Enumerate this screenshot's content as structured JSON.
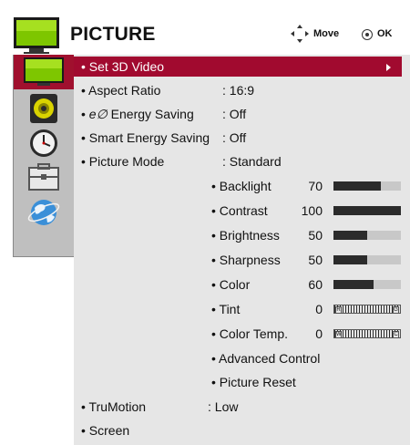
{
  "header": {
    "title": "PICTURE",
    "move_label": "Move",
    "ok_label": "OK"
  },
  "sidebar": {
    "tabs": [
      {
        "icon": "picture-tv-icon",
        "active": true
      },
      {
        "icon": "speaker-icon",
        "active": false
      },
      {
        "icon": "clock-icon",
        "active": false
      },
      {
        "icon": "toolbox-icon",
        "active": false
      },
      {
        "icon": "globe-icon",
        "active": false
      }
    ]
  },
  "menu": {
    "set3d": {
      "label": "• Set 3D Video"
    },
    "aspect": {
      "label": "• Aspect Ratio",
      "value": ": 16:9"
    },
    "energy": {
      "label_prefix": "• ",
      "label_icon": "e∅",
      "label_text": " Energy Saving",
      "value": ": Off"
    },
    "smart": {
      "label": "• Smart Energy Saving",
      "value": ": Off"
    },
    "mode": {
      "label": "• Picture Mode",
      "value": ": Standard"
    },
    "sub": {
      "backlight": {
        "label": "• Backlight",
        "value": "70"
      },
      "contrast": {
        "label": "• Contrast",
        "value": "100"
      },
      "brightness": {
        "label": "• Brightness",
        "value": "50"
      },
      "sharpness": {
        "label": "• Sharpness",
        "value": "50"
      },
      "color": {
        "label": "• Color",
        "value": "60"
      },
      "tint": {
        "label": "• Tint",
        "value": "0",
        "end_left": "R",
        "end_right": "G"
      },
      "colortemp": {
        "label": "• Color Temp.",
        "value": "0",
        "end_left": "W",
        "end_right": "C"
      },
      "advanced": {
        "label": "• Advanced Control"
      },
      "reset": {
        "label": "• Picture Reset"
      }
    },
    "trumotion": {
      "label": "• TruMotion",
      "value": ": Low"
    },
    "screen": {
      "label": "• Screen"
    }
  },
  "levels": {
    "backlight": 0.7,
    "contrast": 1.0,
    "brightness": 0.5,
    "sharpness": 0.5,
    "color": 0.6
  },
  "colors": {
    "selected": "#a10a2f",
    "panel": "#e6e6e6",
    "sidebar": "#bfbfbf",
    "tv_green": "#7ec600"
  }
}
